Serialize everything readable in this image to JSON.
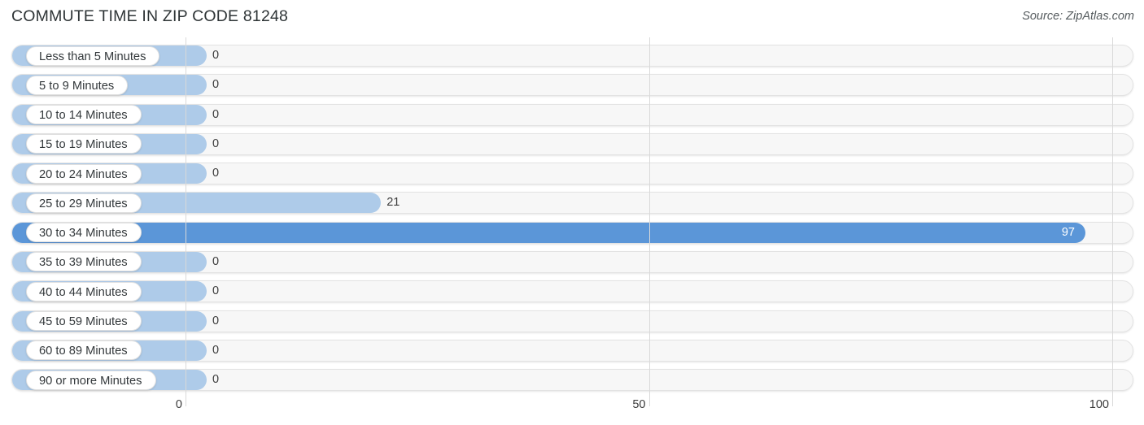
{
  "header": {
    "title": "COMMUTE TIME IN ZIP CODE 81248",
    "source": "Source: ZipAtlas.com"
  },
  "chart_data": {
    "type": "bar",
    "orientation": "horizontal",
    "title": "COMMUTE TIME IN ZIP CODE 81248",
    "xlabel": "",
    "ylabel": "",
    "xlim": [
      0,
      100
    ],
    "xticks": [
      0,
      50,
      100
    ],
    "xtick_labels": [
      "0",
      "50",
      "100"
    ],
    "grid": true,
    "legend": null,
    "categories": [
      "Less than 5 Minutes",
      "5 to 9 Minutes",
      "10 to 14 Minutes",
      "15 to 19 Minutes",
      "20 to 24 Minutes",
      "25 to 29 Minutes",
      "30 to 34 Minutes",
      "35 to 39 Minutes",
      "40 to 44 Minutes",
      "45 to 59 Minutes",
      "60 to 89 Minutes",
      "90 or more Minutes"
    ],
    "values": [
      0,
      0,
      0,
      0,
      0,
      21,
      97,
      0,
      0,
      0,
      0,
      0
    ],
    "value_labels": [
      "0",
      "0",
      "0",
      "0",
      "0",
      "21",
      "97",
      "0",
      "0",
      "0",
      "0",
      "0"
    ],
    "colors": {
      "bar_light": "#aecbe9",
      "bar_highlight": "#5b96d8",
      "track": "#f7f7f7",
      "gridline": "#d9d9d9",
      "label_pill": "#ffffff",
      "text": "#3b3b3b"
    }
  },
  "rows": [
    {
      "label": "Less than 5 Minutes",
      "value": 0,
      "value_label": "0",
      "tone": "light",
      "value_inside": false
    },
    {
      "label": "5 to 9 Minutes",
      "value": 0,
      "value_label": "0",
      "tone": "light",
      "value_inside": false
    },
    {
      "label": "10 to 14 Minutes",
      "value": 0,
      "value_label": "0",
      "tone": "light",
      "value_inside": false
    },
    {
      "label": "15 to 19 Minutes",
      "value": 0,
      "value_label": "0",
      "tone": "light",
      "value_inside": false
    },
    {
      "label": "20 to 24 Minutes",
      "value": 0,
      "value_label": "0",
      "tone": "light",
      "value_inside": false
    },
    {
      "label": "25 to 29 Minutes",
      "value": 21,
      "value_label": "21",
      "tone": "light",
      "value_inside": false
    },
    {
      "label": "30 to 34 Minutes",
      "value": 97,
      "value_label": "97",
      "tone": "dark",
      "value_inside": true
    },
    {
      "label": "35 to 39 Minutes",
      "value": 0,
      "value_label": "0",
      "tone": "light",
      "value_inside": false
    },
    {
      "label": "40 to 44 Minutes",
      "value": 0,
      "value_label": "0",
      "tone": "light",
      "value_inside": false
    },
    {
      "label": "45 to 59 Minutes",
      "value": 0,
      "value_label": "0",
      "tone": "light",
      "value_inside": false
    },
    {
      "label": "60 to 89 Minutes",
      "value": 0,
      "value_label": "0",
      "tone": "light",
      "value_inside": false
    },
    {
      "label": "90 or more Minutes",
      "value": 0,
      "value_label": "0",
      "tone": "light",
      "value_inside": false
    }
  ],
  "axis": {
    "ticks": [
      {
        "label": "0",
        "value": 0
      },
      {
        "label": "50",
        "value": 50
      },
      {
        "label": "100",
        "value": 100
      }
    ]
  }
}
